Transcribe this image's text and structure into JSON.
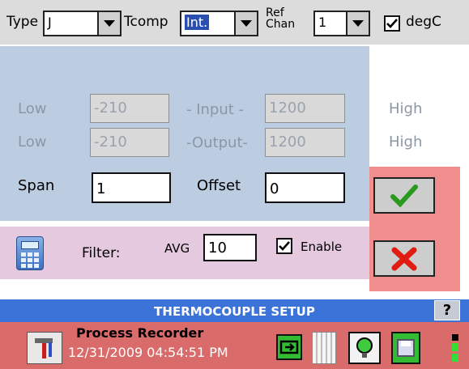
{
  "toolbar": {
    "type_label": "Type",
    "type_value": "J",
    "tcomp_label": "Tcomp",
    "tcomp_value": "Int.",
    "ref_label_line1": "Ref",
    "ref_label_line2": "Chan",
    "ref_value": "1",
    "degc_label": "degC",
    "degc_checked": true
  },
  "input_row": {
    "low_label": "Low",
    "low_value": "-210",
    "mid_label": "- Input -",
    "high_value": "1200",
    "high_label": "High"
  },
  "output_row": {
    "low_label": "Low",
    "low_value": "-210",
    "mid_label": "-Output-",
    "high_value": "1200",
    "high_label": "High"
  },
  "span_row": {
    "span_label": "Span",
    "span_value": "1",
    "offset_label": "Offset",
    "offset_value": "0"
  },
  "filter": {
    "label": "Filter:",
    "avg_label": "AVG",
    "avg_value": "10",
    "enable_label": "Enable",
    "enable_checked": true
  },
  "titlebar": {
    "title": "THERMOCOUPLE SETUP",
    "help_label": "?"
  },
  "statusbar": {
    "app_name": "Process Recorder",
    "datetime": "12/31/2009 04:54:51 PM"
  },
  "colors": {
    "blue_panel": "#bccde1",
    "filter_panel": "#e4c9df",
    "action_panel": "#f08e8e",
    "titlebar": "#3c73d8",
    "statusbar": "#d96b6b",
    "confirm_green": "#2a9a1e",
    "cancel_red": "#e01b12"
  }
}
